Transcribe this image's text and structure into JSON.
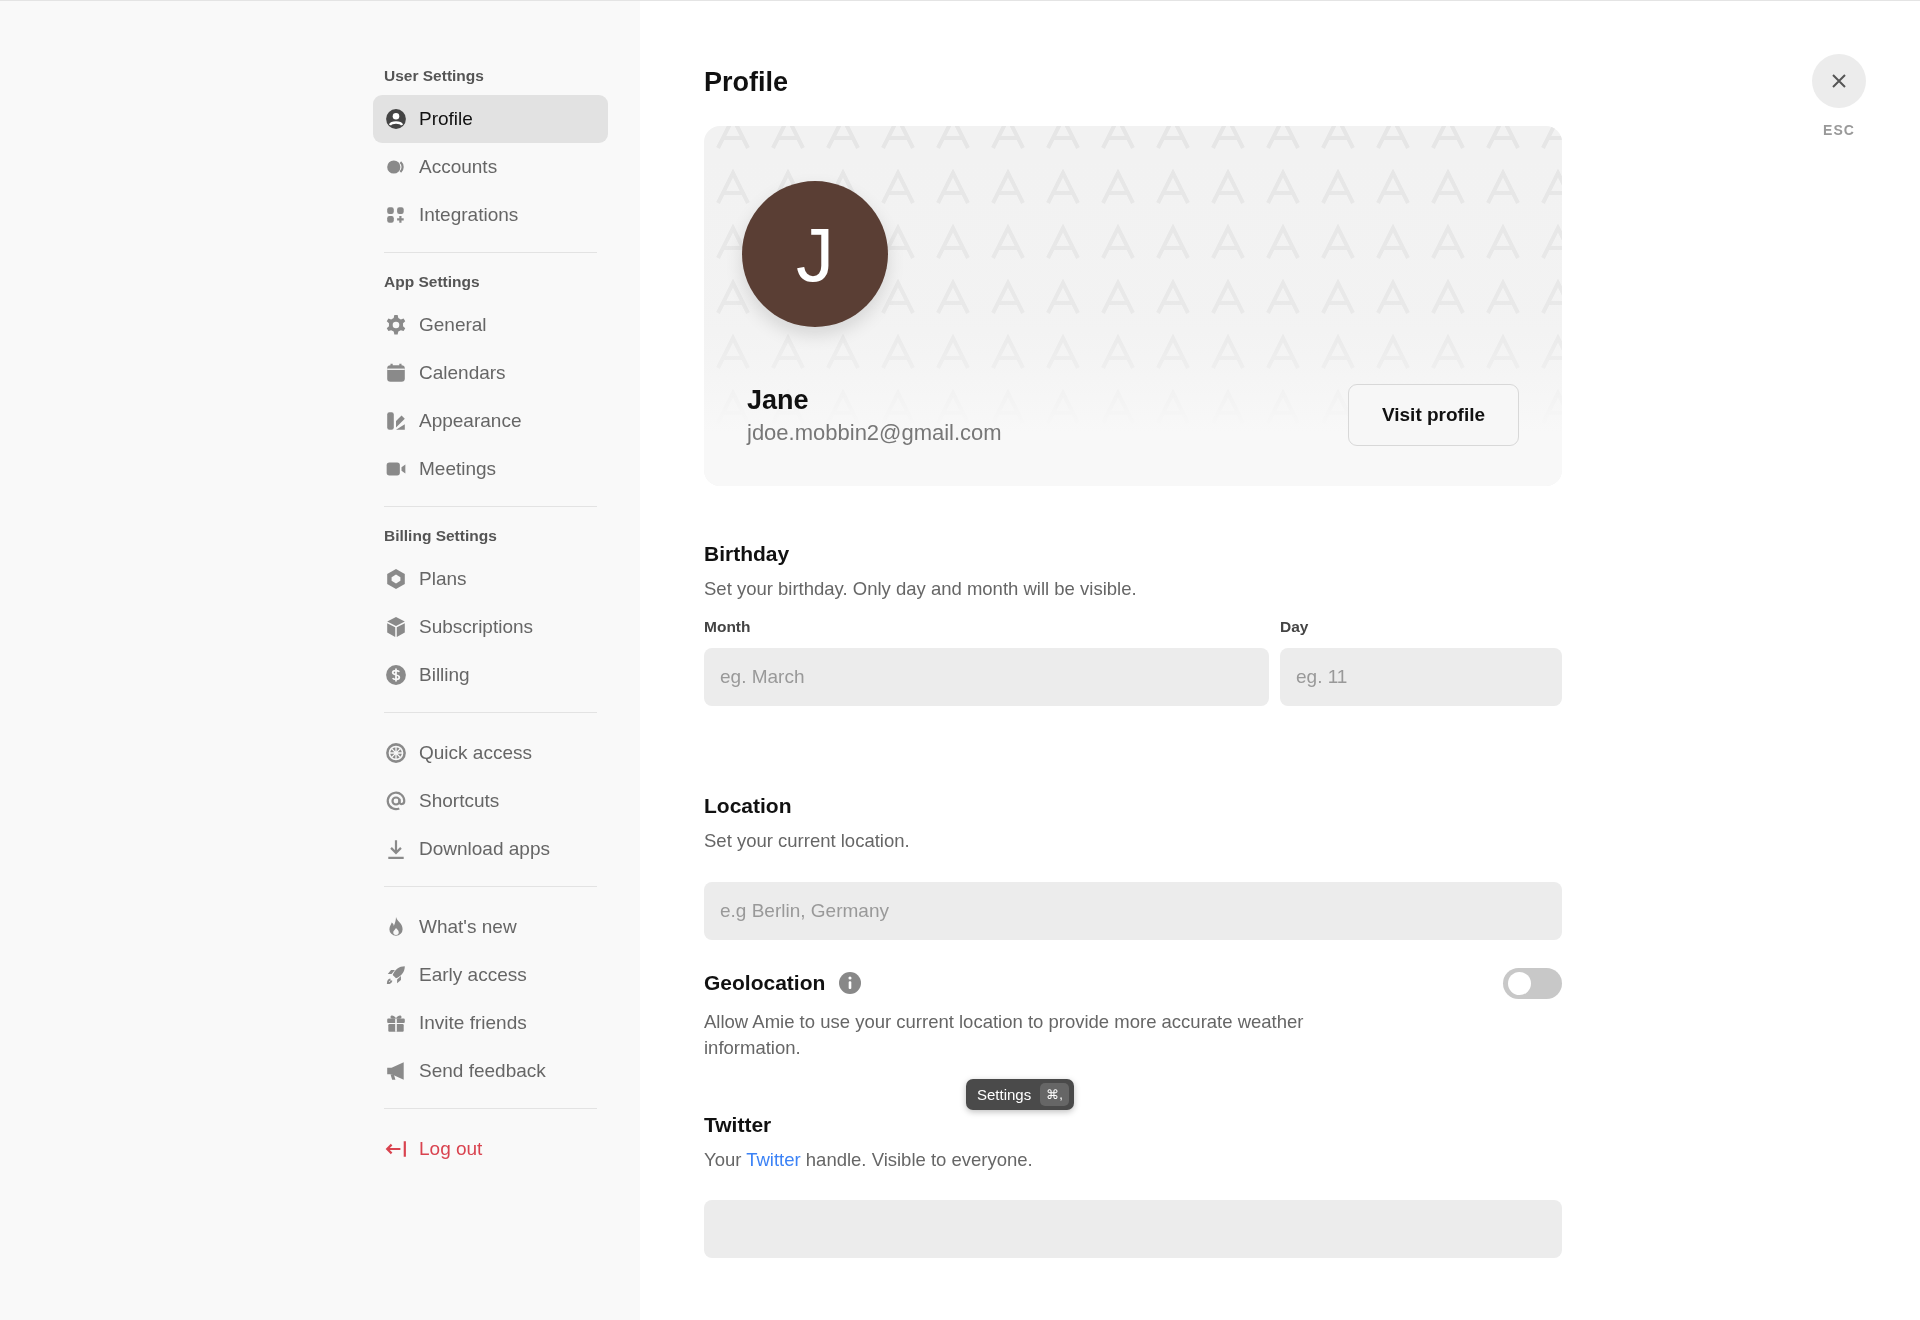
{
  "sidebar": {
    "sections": [
      {
        "heading": "User Settings",
        "items": [
          {
            "label": "Profile",
            "selected": true
          },
          {
            "label": "Accounts",
            "selected": false
          },
          {
            "label": "Integrations",
            "selected": false
          }
        ]
      },
      {
        "heading": "App Settings",
        "items": [
          {
            "label": "General",
            "selected": false
          },
          {
            "label": "Calendars",
            "selected": false
          },
          {
            "label": "Appearance",
            "selected": false
          },
          {
            "label": "Meetings",
            "selected": false
          }
        ]
      },
      {
        "heading": "Billing Settings",
        "items": [
          {
            "label": "Plans",
            "selected": false
          },
          {
            "label": "Subscriptions",
            "selected": false
          },
          {
            "label": "Billing",
            "selected": false
          }
        ]
      },
      {
        "items": [
          {
            "label": "Quick access",
            "selected": false
          },
          {
            "label": "Shortcuts",
            "selected": false
          },
          {
            "label": "Download apps",
            "selected": false
          }
        ]
      },
      {
        "items": [
          {
            "label": "What's new",
            "selected": false
          },
          {
            "label": "Early access",
            "selected": false
          },
          {
            "label": "Invite friends",
            "selected": false
          },
          {
            "label": "Send feedback",
            "selected": false
          }
        ]
      }
    ],
    "logout": {
      "label": "Log out"
    }
  },
  "page": {
    "title": "Profile"
  },
  "close": {
    "hint": "ESC"
  },
  "profile_card": {
    "initial": "J",
    "name": "Jane",
    "email": "jdoe.mobbin2@gmail.com",
    "button": "Visit profile"
  },
  "birthday": {
    "title": "Birthday",
    "description": "Set your birthday. Only day and month will be visible.",
    "fields": [
      {
        "label": "Month",
        "placeholder": "eg. March"
      },
      {
        "label": "Day",
        "placeholder": "eg. 11"
      }
    ]
  },
  "location": {
    "title": "Location",
    "description": "Set your current location.",
    "placeholder": "e.g Berlin, Germany"
  },
  "geolocation": {
    "title": "Geolocation",
    "on": false,
    "description": "Allow Amie to use your current location to provide more accurate weather information."
  },
  "tooltip": {
    "label": "Settings",
    "shortcut": "⌘,"
  },
  "twitter": {
    "title": "Twitter",
    "text_before": "Your ",
    "link": "Twitter",
    "text_after": " handle. Visible to everyone."
  }
}
